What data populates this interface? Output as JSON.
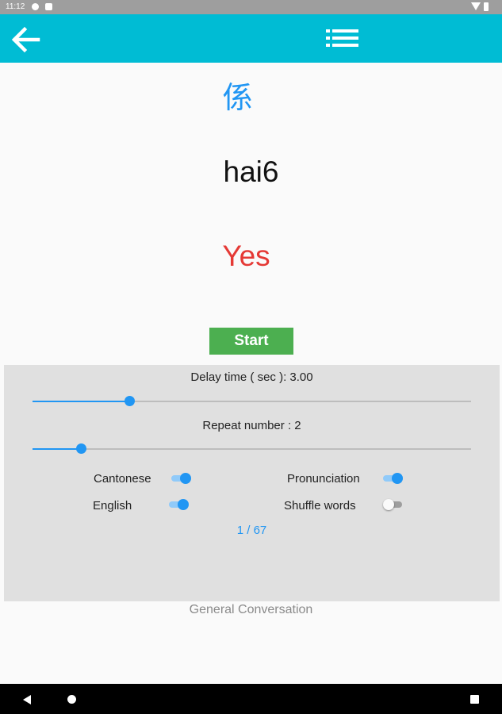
{
  "status_bar": {
    "time": "11:12"
  },
  "toolbar": {
    "back_icon": "arrow-left-icon",
    "menu_icon": "list-icon",
    "background_color": "#00bcd4"
  },
  "card": {
    "character": "係",
    "pronunciation": "hai6",
    "meaning": "Yes",
    "character_color": "#2196f3",
    "meaning_color": "#e53935"
  },
  "start_button": {
    "label": "Start",
    "color": "#4caf50"
  },
  "settings": {
    "delay_label": "Delay time ( sec ): 3.00",
    "delay_value_fraction": 0.22,
    "repeat_label": "Repeat number : 2",
    "repeat_value_fraction": 0.11,
    "options": {
      "cantonese": {
        "label": "Cantonese",
        "on": true
      },
      "pronunciation": {
        "label": "Pronunciation",
        "on": true
      },
      "english": {
        "label": "English",
        "on": true
      },
      "shuffle": {
        "label": "Shuffle words",
        "on": false
      }
    },
    "counter": "1 / 67"
  },
  "category": "General Conversation",
  "accent_color": "#2196f3"
}
